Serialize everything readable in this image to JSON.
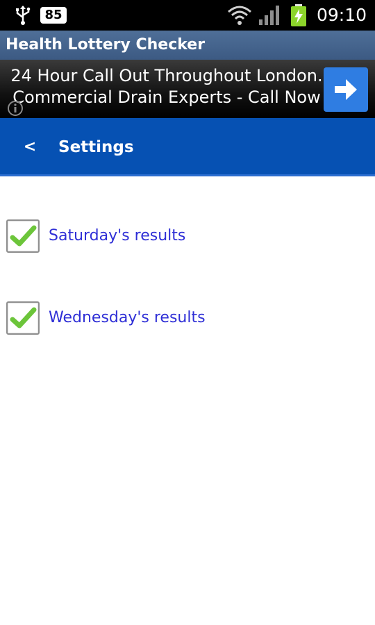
{
  "status_bar": {
    "usb_icon": "usb-icon",
    "notification_badge": "85",
    "wifi_icon": "wifi-icon",
    "signal_icon": "signal-icon",
    "battery_icon": "battery-charging-icon",
    "time": "09:10"
  },
  "app": {
    "title": "Health Lottery Checker"
  },
  "ad": {
    "line1": "24 Hour Call Out Throughout London.",
    "line2": "Commercial Drain Experts - Call Now",
    "info_icon": "info-icon",
    "arrow_icon": "arrow-right-icon",
    "button_color": "#2f7de2"
  },
  "header": {
    "back_label": "<",
    "title": "Settings",
    "background_color": "#0651b3"
  },
  "options": [
    {
      "label": "Saturday's results",
      "checked": true
    },
    {
      "label": "Wednesday's results",
      "checked": true
    }
  ],
  "colors": {
    "option_text": "#2f2fd6",
    "check_green": "#6cc53a"
  }
}
